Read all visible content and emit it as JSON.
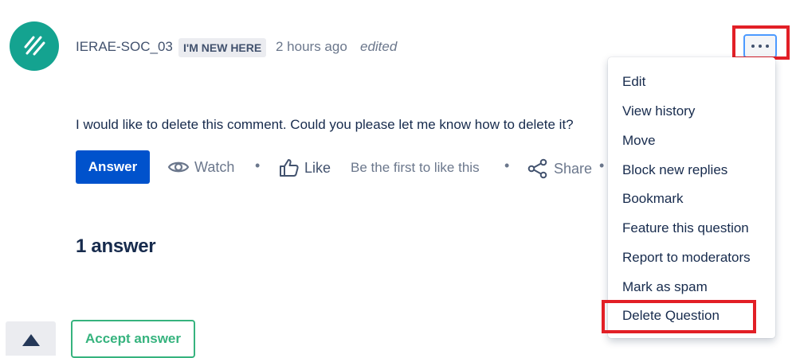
{
  "post": {
    "author": "IERAE-SOC_03",
    "badge": "I'M NEW HERE",
    "time": "2 hours ago",
    "edited": "edited",
    "body": "I would like to delete this comment. Could you please let me know how to delete it?"
  },
  "actions": {
    "answer": "Answer",
    "watch": "Watch",
    "like": "Like",
    "like_prompt": "Be the first to like this",
    "share": "Share",
    "separator": "•"
  },
  "answers": {
    "heading": "1 answer",
    "accept": "Accept answer"
  },
  "menu": {
    "items": [
      "Edit",
      "View history",
      "Move",
      "Block new replies",
      "Bookmark",
      "Feature this question",
      "Report to moderators",
      "Mark as spam",
      "Delete Question"
    ]
  },
  "colors": {
    "primary": "#0052cc",
    "avatar": "#14a390",
    "accept": "#36b37e",
    "highlight": "#e21f26",
    "focus": "#4c9aff"
  },
  "icons": {
    "watch": "eye-icon",
    "like": "thumbs-up-icon",
    "share": "share-icon",
    "more": "more-horizontal-icon",
    "vote": "triangle-up-icon",
    "avatar": "diagonal-stripes-logo"
  }
}
